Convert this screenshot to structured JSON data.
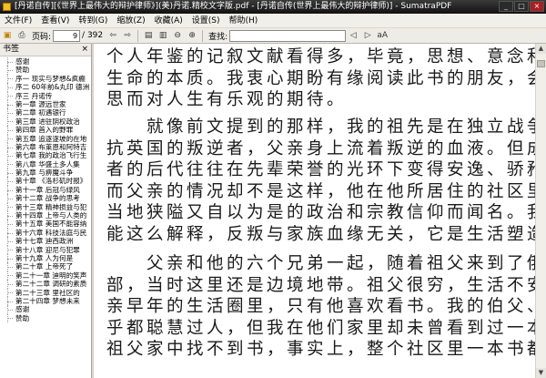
{
  "window": {
    "title": "[丹诺自传][《世界上最伟大的辩护律师》](美)丹诺.精校文字版.pdf - [丹诺自传(世界上最伟大的辩护律师)] - SumatraPDF",
    "buttons": {
      "minimize": "_",
      "maximize": "□",
      "close": "×"
    }
  },
  "menu": [
    "文件(F)",
    "查看(V)",
    "转到(G)",
    "缩放(Z)",
    "收藏(A)",
    "设置(S)",
    "帮助(H)"
  ],
  "toolbar": {
    "page_label": "页码:",
    "page_value": "9",
    "page_total": "/ 392",
    "find_label": "查找:",
    "match_case": "aA",
    "icons": [
      "open-icon",
      "print-icon",
      "prev-page-icon",
      "next-page-icon",
      "fit-page-icon",
      "fit-width-icon",
      "zoom-out-icon",
      "zoom-in-icon",
      "find-prev-icon",
      "find-next-icon",
      "match-case-icon"
    ]
  },
  "sidebar": {
    "title": "书签",
    "close": "×",
    "items": [
      "感谢",
      "赞助",
      "序一 现实与梦想&疯癫",
      "序二 60年前&丸印 德洲",
      "序三 丹诺传",
      "第一章 源远世家",
      "第二章 初遇银行",
      "第三章 进驻阴权政治",
      "第四章 首入的野罪",
      "第五章 追逐逐坡的在地",
      "第六章 布莱恩和阿特吉",
      "第七章 我的政治飞行生",
      "第八章 华盛土多人集",
      "第九章 与痹魔斗争",
      "第十章 《洛杉矶时报》",
      "第十一章 后冠与绿风",
      "第十二章 战争的思考",
      "第十三章 精神损益与犯",
      "第十四章 上帝与人类的",
      "第十五章 美国不能容纳",
      "第十六章 科技法庭与民",
      "第十七章 迪西政洲",
      "第十八章 迎尼与犯罪",
      "第十九章 人为何是",
      "第二十章 上帝死了",
      "第二十一章 迪明的笑声",
      "第二十二章 调研的素质",
      "第二十三章 里社区的",
      "第二十四章 梦想未来",
      "感谢",
      "赞助"
    ]
  },
  "document": {
    "paragraphs": [
      [
        "个人年鉴的记叙文献看得多，毕竟，思想、意念和情感才是",
        "生命的本质。我衷心期盼有缘阅读此书的朋友，会因我的反",
        "思而对人生有乐观的期待。"
      ],
      [
        "就像前文提到的那样，我的祖先是在独立战争中举枪反",
        "抗英国的叛逆者，父亲身上流着叛逆的血液。但成功的反叛",
        "者的后代往往在先辈荣誉的光环下变得安逸、骄矜而脆弱，",
        "而父亲的情况却不是这样，他在他所居住的社区里，以反抗",
        "当地狭隘又自以为是的政治和宗教信仰而闻名。我想，我只",
        "能这么解释，反叛与家族血缘无关，它是生活塑造出来的。"
      ],
      [
        "父亲和他的六个兄弟一起，随着祖父来到了俄亥俄州东",
        "部，当时这里还是边境地带。祖父很穷，生活不安定，在父",
        "亲早年的生活圈里，只有他喜欢看书。我的伯父、姑姑们似",
        "乎都聪慧过人，但我在他们家里却未曾看到过一本书。不只",
        "祖父家中找不到书，事实上，整个社区里一本书都没有，除"
      ]
    ]
  }
}
